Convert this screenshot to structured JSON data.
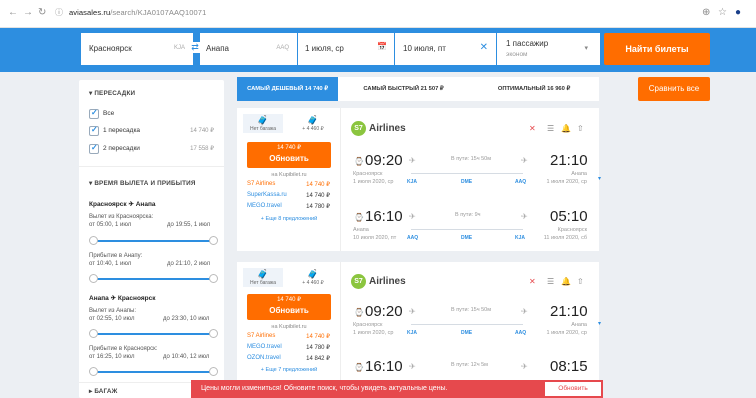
{
  "browser": {
    "url_domain": "aviasales.ru",
    "url_path": "/search/KJA0107AAQ10071",
    "back": "←",
    "forward": "→",
    "reload": "↻",
    "info": "ⓘ",
    "add": "⊕",
    "star": "☆",
    "profile": "●"
  },
  "search": {
    "origin": "Красноярск",
    "origin_code": "KJA",
    "swap": "⇄",
    "destination": "Анапа",
    "destination_code": "AAQ",
    "depart": "1 июля, ср",
    "return": "10 июля, пт",
    "calendar_icon": "📅",
    "clear_icon": "✕",
    "passengers": "1 пассажир",
    "cabin": "эконом",
    "find_button": "Найти билеты"
  },
  "filters": {
    "stops_title": "ПЕРЕСАДКИ",
    "stops": [
      {
        "label": "Все",
        "price": ""
      },
      {
        "label": "1 пересадка",
        "price": "14 740 ₽"
      },
      {
        "label": "2 пересадки",
        "price": "17 558 ₽"
      }
    ],
    "time_title": "ВРЕМЯ ВЫЛЕТА И ПРИБЫТИЯ",
    "leg1_title": "Красноярск",
    "leg1_to": "Анапа",
    "leg1_dep_label": "Вылет из Красноярска:",
    "leg1_dep_from": "от 05:00, 1 июл",
    "leg1_dep_to": "до 19:55, 1 июл",
    "leg1_arr_label": "Прибытие в Анапу:",
    "leg1_arr_from": "от 10:40, 1 июл",
    "leg1_arr_to": "до 21:10, 2 июл",
    "leg2_title": "Анапа",
    "leg2_to": "Красноярск",
    "leg2_dep_label": "Вылет из Анапы:",
    "leg2_dep_from": "от 02:55, 10 июл",
    "leg2_dep_to": "до 23:30, 10 июл",
    "leg2_arr_label": "Прибытие в Красноярск:",
    "leg2_arr_from": "от 16:25, 10 июл",
    "leg2_arr_to": "до 10:40, 12 июл",
    "baggage_title": "БАГАЖ",
    "plane": "✈"
  },
  "tabs": [
    {
      "label": "САМЫЙ ДЕШЕВЫЙ 14 740 ₽",
      "active": true
    },
    {
      "label": "САМЫЙ БЫСТРЫЙ 21 507 ₽",
      "active": false
    },
    {
      "label": "ОПТИМАЛЬНЫЙ 16 960 ₽",
      "active": false
    }
  ],
  "compare_button": "Сравнить все",
  "cards": [
    {
      "bag1_label": "Нет багажа",
      "bag2_label": "+ 4 460 ₽",
      "bag1_icon": "🧳",
      "bag2_icon": "🧳",
      "buy_price": "14 740 ₽",
      "buy_label": "Обновить",
      "via": "на Kupibilet.ru",
      "agents": [
        {
          "name": "S7 Airlines",
          "price": "14 740 ₽"
        },
        {
          "name": "SuperKassa.ru",
          "price": "14 740 ₽"
        },
        {
          "name": "MEGO.travel",
          "price": "14 780 ₽"
        }
      ],
      "more": "+ Еще 8 предложений",
      "airline": "Airlines",
      "logo": "S7",
      "flights": [
        {
          "dep": "09:20",
          "arr": "21:10",
          "dep_city": "Красноярск",
          "dep_date": "1 июля 2020, ср",
          "arr_city": "Анапа",
          "arr_date": "1 июля 2020, ср",
          "dur": "В пути: 15ч 50м",
          "c1": "KJA",
          "c2": "DME",
          "c3": "AAQ"
        },
        {
          "dep": "16:10",
          "arr": "05:10",
          "dep_city": "Анапа",
          "dep_date": "10 июля 2020, пт",
          "arr_city": "Красноярск",
          "arr_date": "11 июля 2020, сб",
          "dur": "В пути: 9ч",
          "c1": "AAQ",
          "c2": "DME",
          "c3": "KJA"
        }
      ]
    },
    {
      "bag1_label": "Нет багажа",
      "bag2_label": "+ 4 460 ₽",
      "bag1_icon": "🧳",
      "bag2_icon": "🧳",
      "buy_price": "14 740 ₽",
      "buy_label": "Обновить",
      "via": "на Kupibilet.ru",
      "agents": [
        {
          "name": "S7 Airlines",
          "price": "14 740 ₽"
        },
        {
          "name": "MEGO.travel",
          "price": "14 780 ₽"
        },
        {
          "name": "OZON.travel",
          "price": "14 842 ₽"
        }
      ],
      "more": "+ Еще 7 предложений",
      "airline": "Airlines",
      "logo": "S7",
      "flights": [
        {
          "dep": "09:20",
          "arr": "21:10",
          "dep_city": "Красноярск",
          "dep_date": "1 июля 2020, ср",
          "arr_city": "Анапа",
          "arr_date": "1 июля 2020, ср",
          "dur": "В пути: 15ч 50м",
          "c1": "KJA",
          "c2": "DME",
          "c3": "AAQ"
        },
        {
          "dep": "16:10",
          "arr": "08:15",
          "dep_city": "",
          "dep_date": "",
          "arr_city": "",
          "arr_date": "",
          "dur": "В пути: 12ч 5м",
          "c1": "",
          "c2": "",
          "c3": ""
        }
      ]
    }
  ],
  "toast": {
    "text": "Цены могли измениться! Обновите поиск, чтобы увидеть актуальные цены.",
    "button": "Обновить"
  },
  "icons": {
    "clock": "⌚",
    "plane": "✈",
    "land": "✈",
    "close": "✕",
    "filter": "☰",
    "bell": "🔔",
    "share": "⇧",
    "chevron": "▾"
  }
}
